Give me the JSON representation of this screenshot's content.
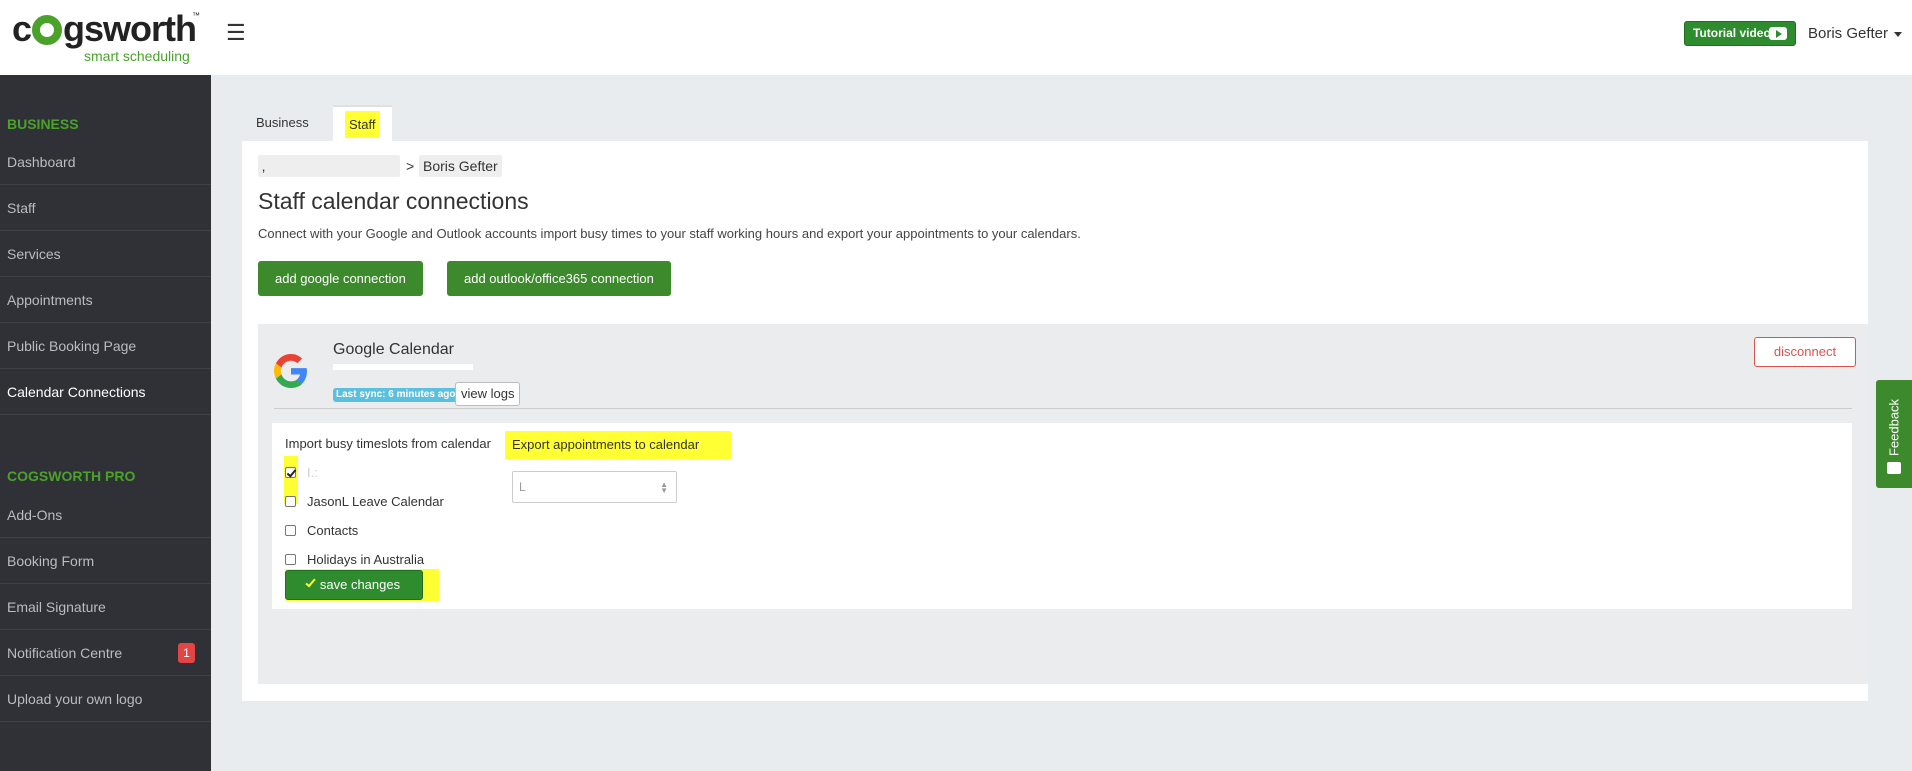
{
  "header": {
    "logo_word": "cogsworth",
    "logo_tm": "™",
    "logo_tagline": "smart scheduling",
    "menu_icon": "hamburger-icon",
    "tutorial_label": "Tutorial video",
    "user_name": "Boris Gefter"
  },
  "sidebar": {
    "business_heading": "BUSINESS",
    "business_items": [
      {
        "label": "Dashboard"
      },
      {
        "label": "Staff"
      },
      {
        "label": "Services"
      },
      {
        "label": "Appointments"
      },
      {
        "label": "Public Booking Page"
      },
      {
        "label": "Calendar Connections",
        "active": true
      }
    ],
    "pro_heading": "COGSWORTH PRO",
    "pro_items": [
      {
        "label": "Add-Ons"
      },
      {
        "label": "Booking Form"
      },
      {
        "label": "Email Signature"
      },
      {
        "label": "Notification Centre",
        "badge": "1"
      },
      {
        "label": "Upload your own logo"
      }
    ]
  },
  "tabs": [
    {
      "label": "Business"
    },
    {
      "label": "Staff",
      "active": true
    }
  ],
  "breadcrumb": {
    "first": "‚",
    "separator": ">",
    "current": "Boris Gefter"
  },
  "main": {
    "title": "Staff calendar connections",
    "description": "Connect with your Google and Outlook accounts import busy times to your staff working hours and export your appointments to your calendars.",
    "add_google_label": "add google connection",
    "add_outlook_label": "add outlook/office365 connection"
  },
  "connection": {
    "name": "Google Calendar",
    "sync_status": "Last sync: 6 minutes ago",
    "view_logs_label": "view logs",
    "disconnect_label": "disconnect",
    "import_title": "Import busy timeslots from calendar",
    "calendars": [
      {
        "label": "I.:",
        "checked": true
      },
      {
        "label": "JasonL Leave Calendar",
        "checked": false
      },
      {
        "label": "Contacts",
        "checked": false
      },
      {
        "label": "Holidays in Australia",
        "checked": false
      }
    ],
    "export_title": "Export appointments to calendar",
    "export_selected": "L",
    "save_label": "save changes"
  },
  "feedback_label": "Feedback",
  "colors": {
    "brand_green": "#4aa22b",
    "button_green": "#3c8a2c",
    "sidebar_bg": "#2f3136",
    "highlight_yellow": "#ffff33",
    "danger": "#d9534f",
    "info_badge": "#5bc0de"
  }
}
